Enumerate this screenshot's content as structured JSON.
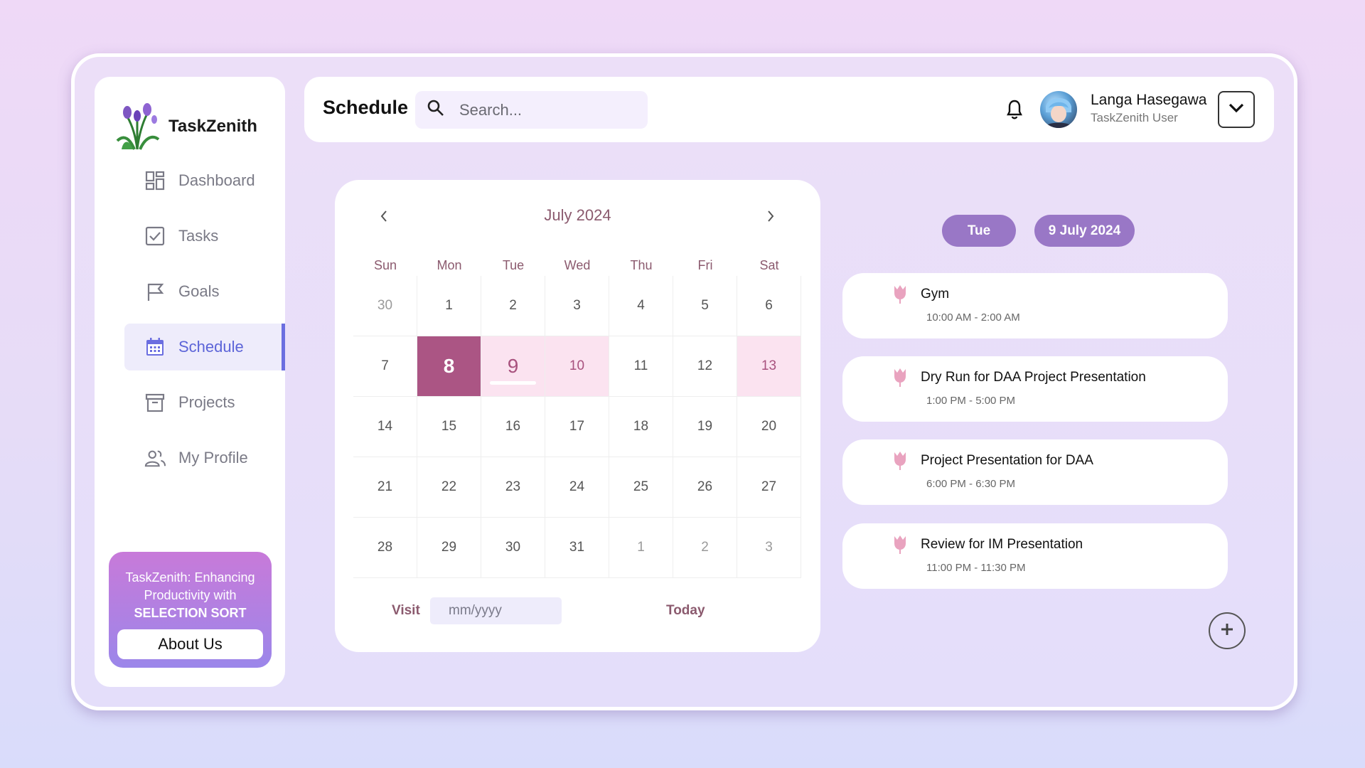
{
  "app": {
    "name": "TaskZenith"
  },
  "sidebar": {
    "items": [
      {
        "label": "Dashboard",
        "icon": "dashboard-icon"
      },
      {
        "label": "Tasks",
        "icon": "checkbox-icon"
      },
      {
        "label": "Goals",
        "icon": "flag-icon"
      },
      {
        "label": "Schedule",
        "icon": "calendar-icon",
        "active": true
      },
      {
        "label": "Projects",
        "icon": "archive-icon"
      },
      {
        "label": "My Profile",
        "icon": "users-icon"
      }
    ],
    "promo": {
      "line1": "TaskZenith: Enhancing",
      "line2": "Productivity with",
      "strong": "SELECTION SORT",
      "button": "About Us"
    }
  },
  "header": {
    "title": "Schedule",
    "search_placeholder": "Search...",
    "user_name": "Langa Hasegawa",
    "user_role": "TaskZenith User"
  },
  "calendar": {
    "month_label": "July 2024",
    "days_of_week": [
      "Sun",
      "Mon",
      "Tue",
      "Wed",
      "Thu",
      "Fri",
      "Sat"
    ],
    "weeks": [
      [
        "30",
        "1",
        "2",
        "3",
        "4",
        "5",
        "6"
      ],
      [
        "7",
        "8",
        "9",
        "10",
        "11",
        "12",
        "13"
      ],
      [
        "14",
        "15",
        "16",
        "17",
        "18",
        "19",
        "20"
      ],
      [
        "21",
        "22",
        "23",
        "24",
        "25",
        "26",
        "27"
      ],
      [
        "28",
        "29",
        "30",
        "31",
        "1",
        "2",
        "3"
      ]
    ],
    "today": "8",
    "selected": "9",
    "highlighted": [
      "10",
      "13"
    ],
    "visit_label": "Visit",
    "visit_placeholder": "mm/yyyy",
    "today_label": "Today"
  },
  "schedule": {
    "day_name": "Tue",
    "date": "9 July 2024",
    "events": [
      {
        "title": "Gym",
        "time": "10:00 AM - 2:00 AM"
      },
      {
        "title": "Dry Run for DAA Project Presentation",
        "time": "1:00 PM - 5:00 PM"
      },
      {
        "title": "Project Presentation for DAA",
        "time": "6:00 PM - 6:30 PM"
      },
      {
        "title": "Review for IM Presentation",
        "time": "11:00 PM - 11:30 PM"
      }
    ]
  },
  "colors": {
    "accent": "#6b6ee0",
    "today_bg": "#ab5584",
    "highlight_bg": "#fbe3f0",
    "pill_bg": "#9977c6",
    "tulip": "#e9a3bf"
  }
}
